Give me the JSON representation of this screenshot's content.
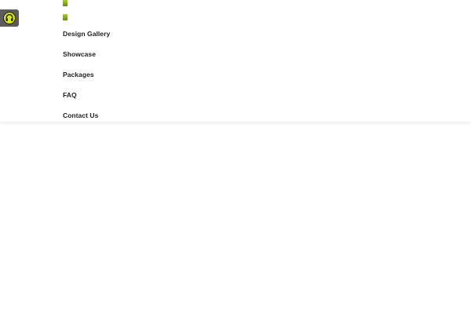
{
  "menu": {
    "items": [
      {
        "label": "Design Gallery"
      },
      {
        "label": "Showcase"
      },
      {
        "label": "Packages"
      },
      {
        "label": "FAQ"
      },
      {
        "label": "Contact Us"
      }
    ]
  },
  "colors": {
    "accent": "#8dbb1d",
    "accessibility_button": "#5c5c5c",
    "accessibility_icon": "#d7e90b"
  },
  "icons": {
    "accessibility": "headphones-icon",
    "marker": "green-square-icon"
  }
}
